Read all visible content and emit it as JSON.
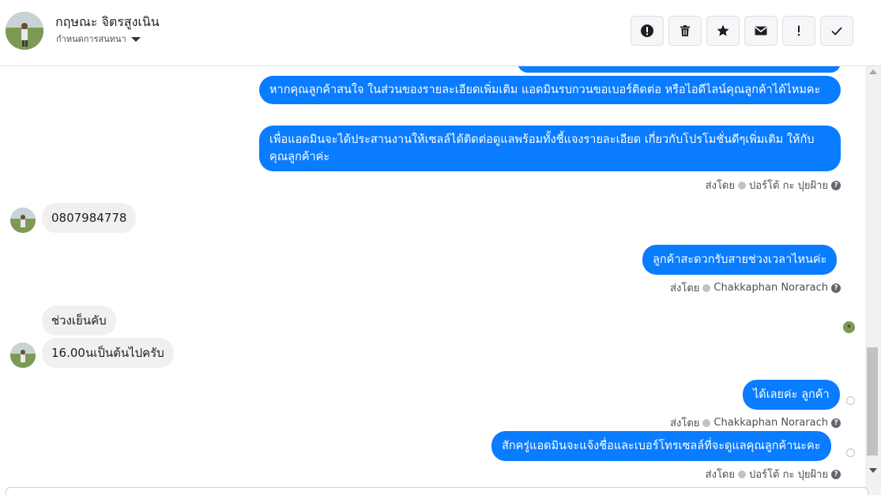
{
  "header": {
    "contact_name": "กฤษณะ จิตรสูงเนิน",
    "conversation_settings_label": "กำหนดการสนทนา",
    "toolbar": [
      {
        "name": "report-icon",
        "label": "Report"
      },
      {
        "name": "trash-icon",
        "label": "Delete"
      },
      {
        "name": "star-icon",
        "label": "Star"
      },
      {
        "name": "mail-icon",
        "label": "Mark unread"
      },
      {
        "name": "exclamation-icon",
        "label": "Mark important"
      },
      {
        "name": "check-icon",
        "label": "Mark done"
      }
    ]
  },
  "messages": {
    "out1": "หากคุณลูกค้าสนใจ ในส่วนของรายละเอียดเพิ่มเติม แอดมินรบกวนขอเบอร์ติดต่อ หรือไอดีไลน์คุณลูกค้าได้ไหมคะ",
    "out2": "เพื่อแอดมินจะได้ประสานงานให้เซลล์ได้ติดต่อดูแลพร้อมทั้งชี้แจงรายละเอียด เกี่ยวกับโปรโมชั่นดีๆเพิ่มเติม ให้กับคุณลูกค้าค่ะ",
    "sent_by_1": "ส่งโดย",
    "sender_1": "ปอร์โต้ กะ ปุยฝ้าย",
    "in1": "0807984778",
    "out3": "ลูกค้าสะดวกรับสายช่วงเวลาไหนค่ะ",
    "sent_by_2": "ส่งโดย",
    "sender_2": "Chakkaphan Norarach",
    "in2": "ช่วงเย็นคับ",
    "in3": "16.00นเป็นต้นไปครับ",
    "out4": "ได้เลยค่ะ ลูกค้า",
    "sent_by_3": "ส่งโดย",
    "sender_3": "Chakkaphan Norarach",
    "out5": "สักครู่แอดมินจะแจ้งชื่อและเบอร์โทรเซลล์ที่จะดูแลคุณลูกค้านะคะ",
    "sent_by_4": "ส่งโดย",
    "sender_4": "ปอร์โต้ กะ ปุยฝ้าย"
  },
  "colors": {
    "outgoing_bubble": "#0a7cff",
    "incoming_bubble": "#f0f0f0"
  }
}
